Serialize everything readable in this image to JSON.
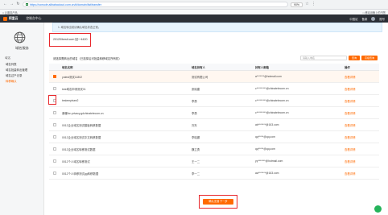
{
  "browser": {
    "url": "https://console.alibabacloud.com.cn/#/domain/list/transfer",
    "zoom": "90%",
    "bookmarks_left": "□ 云服务产品",
    "bookmarks_right": "□ 移动设备上的书签"
  },
  "header": {
    "brand": "阿里云",
    "console_link": "控制台中心",
    "right_items": [
      "中国站",
      "备案",
      "账号"
    ]
  },
  "sidebar": {
    "title": "域名服务",
    "section": "域名",
    "items": [
      {
        "label": "域名列表"
      },
      {
        "label": "域名批量转出管理"
      },
      {
        "label": "域名过户记录"
      },
      {
        "label": "转移确认",
        "active": true
      }
    ]
  },
  "content": {
    "notice": "1. 域名转出前请确认域名状态正常。",
    "domain_text": "20120/bestl.com 回一4420",
    "section_title": "请选择需转出的域名（已选择后可批量转移域名所有权）",
    "search_placeholder": "请输入域名",
    "search_button": "查询",
    "advanced_button": "高级查询",
    "columns": [
      "域名名称",
      "域名持有人",
      "持有人邮箱",
      "操作"
    ],
    "rows": [
      {
        "domain": "yutest测试11802",
        "holder": "测试有限公司",
        "email": "a*******@hotmail.com",
        "op": "查看详情",
        "selected": true
      },
      {
        "domain": "test域名申请测试01",
        "holder": "张晓建",
        "email": "c*********@chinatelecom.cn",
        "op": "查看详情"
      },
      {
        "domain": "testemptsee2",
        "holder": "李勇",
        "email": "c*********@chinatelecom.cn",
        "op": "查看详情"
      },
      {
        "domain": "素暖for-privacy.gdchinatelecom.cn",
        "holder": "李勇",
        "email": "c*********@chinatelecom.cn",
        "op": "查看详情"
      },
      {
        "domain": "0012企业域名测试模板转移数据",
        "holder": "刘东",
        "email": "ab*******@163.com",
        "op": "查看详情"
      },
      {
        "domain": "0012企业域名测试中文转移数据",
        "holder": "李晓娜",
        "email": "qq*****@qq.com",
        "op": "查看详情"
      },
      {
        "domain": "0012企业域名转移测试数据",
        "holder": "魏立勇",
        "email": "qq*****@qq.com",
        "op": "查看详情"
      },
      {
        "domain": "0012个人域名转移测试",
        "holder": "王一二",
        "email": "yy*******@hotmail.com",
        "op": "查看详情"
      },
      {
        "domain": "0012个人转移测试gg转移数据",
        "holder": "李一二",
        "email": "aa*******@163.com",
        "op": "查看详情"
      }
    ],
    "next_button": "确认无误 下一步"
  },
  "colors": {
    "accent": "#ff6a00",
    "annotation": "#e8262b",
    "header_bg": "#2b2f36"
  }
}
